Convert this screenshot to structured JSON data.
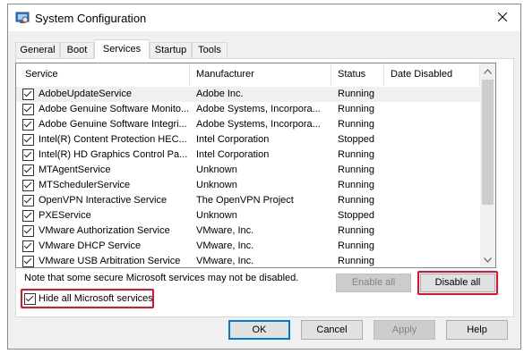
{
  "window": {
    "title": "System Configuration"
  },
  "tabs": [
    {
      "label": "General"
    },
    {
      "label": "Boot"
    },
    {
      "label": "Services"
    },
    {
      "label": "Startup"
    },
    {
      "label": "Tools"
    }
  ],
  "active_tab": "Services",
  "table": {
    "columns": [
      "Service",
      "Manufacturer",
      "Status",
      "Date Disabled"
    ],
    "rows": [
      {
        "checked": true,
        "service": "AdobeUpdateService",
        "manufacturer": "Adobe Inc.",
        "status": "Running",
        "date": ""
      },
      {
        "checked": true,
        "service": "Adobe Genuine Software Monito...",
        "manufacturer": "Adobe Systems, Incorpora...",
        "status": "Running",
        "date": ""
      },
      {
        "checked": true,
        "service": "Adobe Genuine Software Integri...",
        "manufacturer": "Adobe Systems, Incorpora...",
        "status": "Running",
        "date": ""
      },
      {
        "checked": true,
        "service": "Intel(R) Content Protection HEC...",
        "manufacturer": "Intel Corporation",
        "status": "Stopped",
        "date": ""
      },
      {
        "checked": true,
        "service": "Intel(R) HD Graphics Control Pa...",
        "manufacturer": "Intel Corporation",
        "status": "Running",
        "date": ""
      },
      {
        "checked": true,
        "service": "MTAgentService",
        "manufacturer": "Unknown",
        "status": "Running",
        "date": ""
      },
      {
        "checked": true,
        "service": "MTSchedulerService",
        "manufacturer": "Unknown",
        "status": "Running",
        "date": ""
      },
      {
        "checked": true,
        "service": "OpenVPN Interactive Service",
        "manufacturer": "The OpenVPN Project",
        "status": "Running",
        "date": ""
      },
      {
        "checked": true,
        "service": "PXEService",
        "manufacturer": "Unknown",
        "status": "Stopped",
        "date": ""
      },
      {
        "checked": true,
        "service": "VMware Authorization Service",
        "manufacturer": "VMware, Inc.",
        "status": "Running",
        "date": ""
      },
      {
        "checked": true,
        "service": "VMware DHCP Service",
        "manufacturer": "VMware, Inc.",
        "status": "Running",
        "date": ""
      },
      {
        "checked": true,
        "service": "VMware USB Arbitration Service",
        "manufacturer": "VMware, Inc.",
        "status": "Running",
        "date": ""
      }
    ]
  },
  "note": "Note that some secure Microsoft services may not be disabled.",
  "buttons": {
    "enable_all": "Enable all",
    "disable_all": "Disable all",
    "ok": "OK",
    "cancel": "Cancel",
    "apply": "Apply",
    "help": "Help"
  },
  "hide_ms": {
    "label": "Hide all Microsoft services",
    "checked": true
  },
  "colors": {
    "highlight": "#e81123",
    "accent": "#0078d7"
  },
  "icons": [
    "system-config-icon",
    "close-icon",
    "scroll-up-icon",
    "scroll-down-icon",
    "checkbox-checked-icon"
  ]
}
